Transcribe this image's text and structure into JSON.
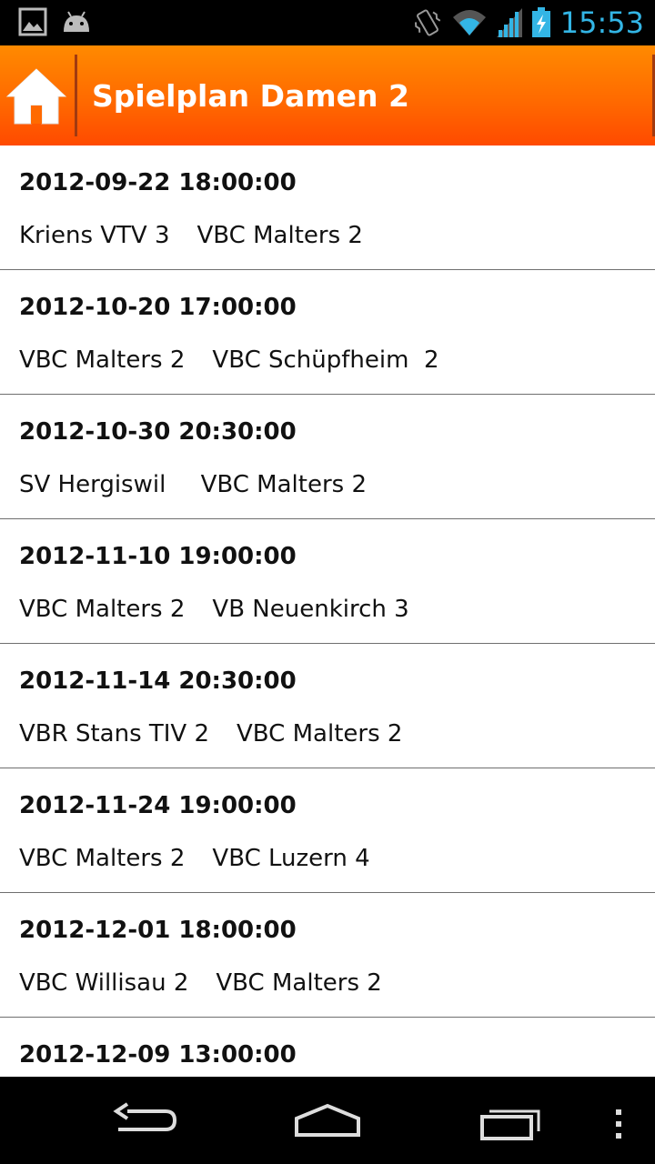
{
  "status_bar": {
    "time": "15:53",
    "icons": [
      "image-icon",
      "android-icon",
      "vibrate-icon",
      "wifi-icon",
      "signal-icon",
      "battery-charging-icon"
    ],
    "accent_color": "#33b5e5"
  },
  "action_bar": {
    "title": "Spielplan Damen 2",
    "home_icon": "home-icon",
    "gradient_colors": [
      "#ff8a00",
      "#ff4a00"
    ]
  },
  "games": [
    {
      "date": "2012-09-22 18:00:00",
      "home": "Kriens VTV 3",
      "away": "VBC Malters 2"
    },
    {
      "date": "2012-10-20 17:00:00",
      "home": "VBC Malters 2",
      "away": "VBC Schüpfheim  2"
    },
    {
      "date": "2012-10-30 20:30:00",
      "home": "SV Hergiswil ",
      "away": "VBC Malters 2"
    },
    {
      "date": "2012-11-10 19:00:00",
      "home": "VBC Malters 2",
      "away": "VB Neuenkirch 3"
    },
    {
      "date": "2012-11-14 20:30:00",
      "home": "VBR Stans TIV 2",
      "away": "VBC Malters 2"
    },
    {
      "date": "2012-11-24 19:00:00",
      "home": "VBC Malters 2",
      "away": "VBC Luzern 4"
    },
    {
      "date": "2012-12-01 18:00:00",
      "home": "VBC Willisau 2",
      "away": "VBC Malters 2"
    },
    {
      "date": "2012-12-09 13:00:00",
      "home": "",
      "away": ""
    }
  ],
  "nav_bar": {
    "icons": [
      "back-icon",
      "home-nav-icon",
      "recent-apps-icon",
      "overflow-menu-icon"
    ]
  }
}
